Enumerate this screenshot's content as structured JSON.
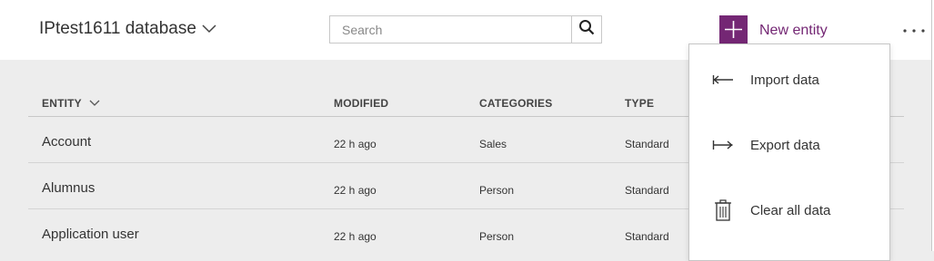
{
  "header": {
    "database_name": "IPtest1611 database",
    "search_placeholder": "Search",
    "new_entity_label": "New entity"
  },
  "table": {
    "columns": {
      "entity": "ENTITY",
      "modified": "MODIFIED",
      "categories": "CATEGORIES",
      "type": "TYPE"
    },
    "rows": [
      {
        "entity": "Account",
        "modified": "22 h ago",
        "category": "Sales",
        "type": "Standard"
      },
      {
        "entity": "Alumnus",
        "modified": "22 h ago",
        "category": "Person",
        "type": "Standard"
      },
      {
        "entity": "Application user",
        "modified": "22 h ago",
        "category": "Person",
        "type": "Standard"
      }
    ]
  },
  "dropdown_menu": {
    "items": [
      {
        "label": "Import data",
        "icon": "import-arrow-icon"
      },
      {
        "label": "Export data",
        "icon": "export-arrow-icon"
      },
      {
        "label": "Clear all data",
        "icon": "trash-icon"
      }
    ]
  },
  "colors": {
    "accent": "#742774",
    "background": "#ededed",
    "header_background": "#ffffff"
  }
}
